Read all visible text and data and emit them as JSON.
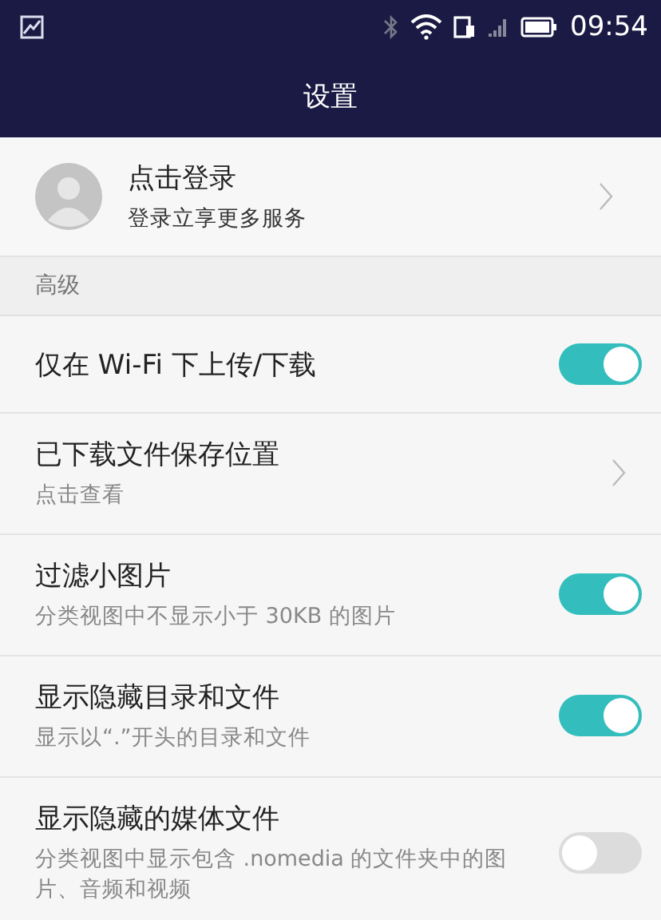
{
  "status_bar": {
    "time": "09:54"
  },
  "title": "设置",
  "account": {
    "name": "点击登录",
    "subtitle": "登录立享更多服务"
  },
  "section": "高级",
  "settings": [
    {
      "kind": "toggle",
      "label": "仅在 Wi-Fi 下上传/下载",
      "on": true
    },
    {
      "kind": "link",
      "label": "已下载文件保存位置",
      "subtitle": "点击查看"
    },
    {
      "kind": "toggle",
      "label": "过滤小图片",
      "subtitle": "分类视图中不显示小于 30KB 的图片",
      "on": true
    },
    {
      "kind": "toggle",
      "label": "显示隐藏目录和文件",
      "subtitle": "显示以“.”开头的目录和文件",
      "on": true
    },
    {
      "kind": "toggle",
      "label": "显示隐藏的媒体文件",
      "subtitle": "分类视图中显示包含 .nomedia 的文件夹中的图片、音频和视频",
      "on": false
    }
  ]
}
